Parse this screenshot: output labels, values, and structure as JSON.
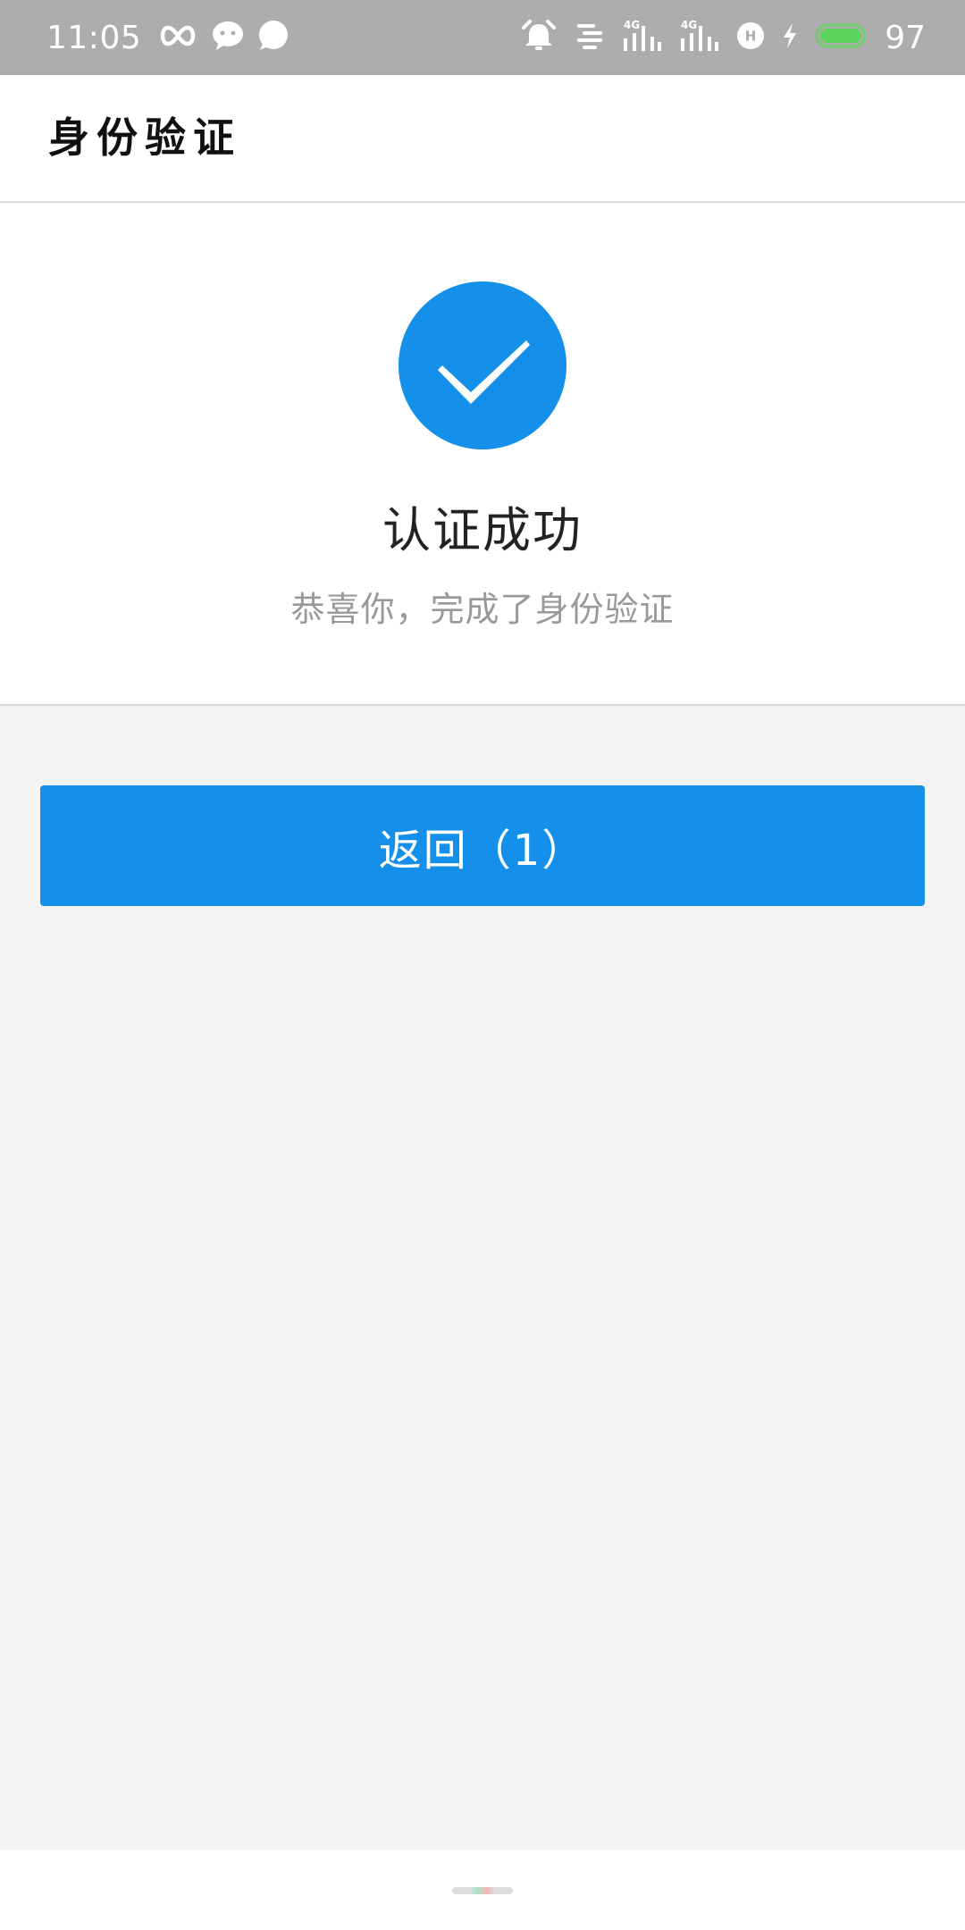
{
  "status_bar": {
    "time": "11:05",
    "battery_level": "97",
    "network_1": "4G",
    "network_2": "4G",
    "hd_label": "H",
    "icons": [
      "infinity-icon",
      "wechat-icon",
      "message-icon",
      "alarm-icon",
      "notification-list-icon",
      "signal-4g-icon",
      "signal-4g-icon",
      "hd-icon",
      "charging-icon",
      "battery-icon"
    ],
    "battery_color": "#5ad45a"
  },
  "header": {
    "title": "身份验证"
  },
  "result": {
    "icon": "check-circle-icon",
    "title": "认证成功",
    "subtitle": "恭喜你，完成了身份验证"
  },
  "actions": {
    "back_label": "返回（1）"
  },
  "colors": {
    "accent": "#1590ea",
    "status_bar": "#adadad",
    "background": "#f4f4f4"
  }
}
